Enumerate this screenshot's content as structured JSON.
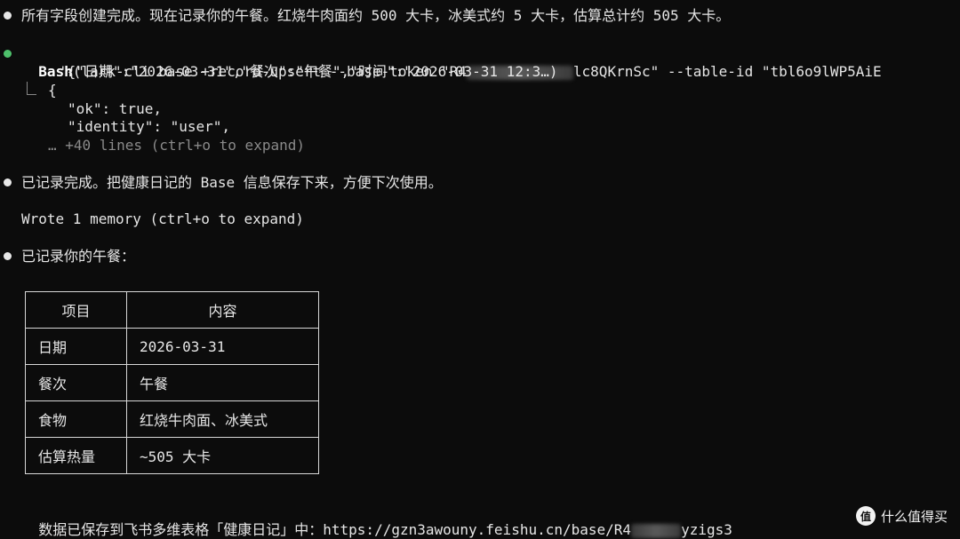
{
  "messages": {
    "summary_1": "所有字段创建完成。现在记录你的午餐。红烧牛肉面约 500 大卡，冰美式约 5 大卡，估算总计约 505 大卡。",
    "bash_cmd_prefix": "Bash",
    "bash_cmd_args_a": "(lark-cli base +record-upsert --base-token \"R4",
    "bash_cmd_args_b": "lc8QKrnSc\" --table-id \"tbl6o9lWP5AiE",
    "bash_cmd_line2": "'{\"日期\":\"2026-03-31\",\"餐次\":\"午餐\",\"时间\":\"2026-03-31 12:3…)",
    "output_brace": "{",
    "output_ok": "\"ok\": true,",
    "output_identity": "\"identity\": \"user\",",
    "output_more": "… +40 lines (ctrl+o to expand)",
    "saved_msg": "已记录完成。把健康日记的 Base 信息保存下来，方便下次使用。",
    "memory_msg": "Wrote 1 memory (ctrl+o to expand)",
    "recorded_title": "已记录你的午餐：",
    "footer_prefix": "数据已保存到飞书多维表格「健康日记」中：https://gzn3awouny.feishu.cn/base/R4",
    "footer_suffix": "yzigs3"
  },
  "table": {
    "headers": [
      "项目",
      "内容"
    ],
    "rows": [
      [
        "日期",
        "2026-03-31"
      ],
      [
        "餐次",
        "午餐"
      ],
      [
        "食物",
        "红烧牛肉面、冰美式"
      ],
      [
        "估算热量",
        "~505 大卡"
      ]
    ]
  },
  "watermark": {
    "icon_text": "值",
    "label": "什么值得买"
  },
  "colors": {
    "background": "#0c0c0c",
    "bullet_success": "#4ec06b",
    "bullet_default": "#e8e8e8"
  }
}
